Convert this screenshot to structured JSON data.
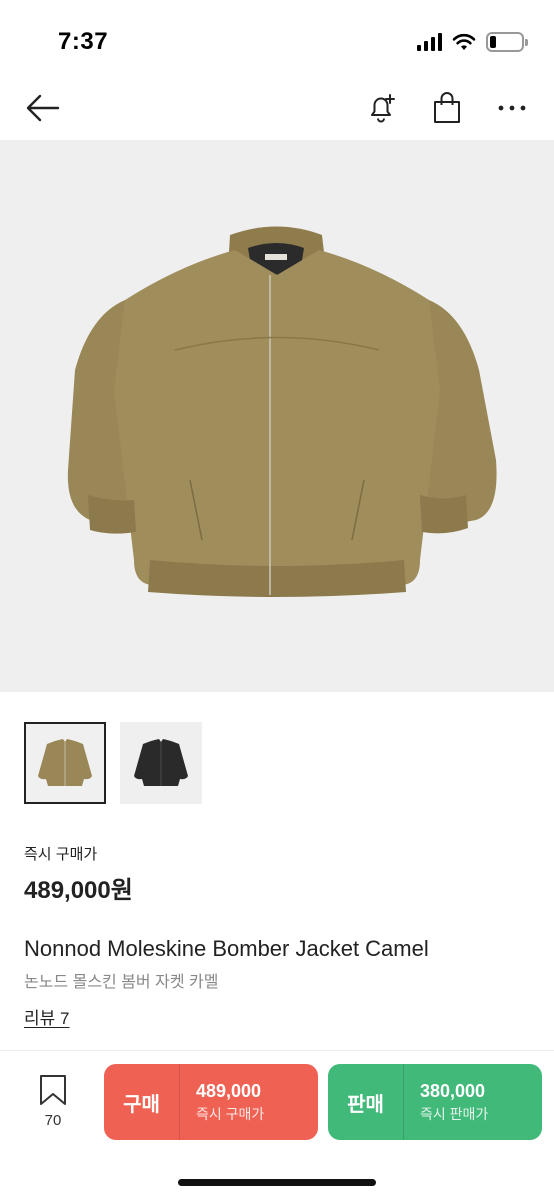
{
  "status_bar": {
    "time": "7:37",
    "battery_level": 0.2
  },
  "nav": {
    "back_icon": "arrow-left-icon",
    "alert_icon": "bell-plus-icon",
    "bag_icon": "shopping-bag-icon",
    "more_icon": "more-horizontal-icon"
  },
  "gallery": {
    "thumbnails": [
      {
        "color": "camel",
        "selected": true
      },
      {
        "color": "black",
        "selected": false
      }
    ]
  },
  "price": {
    "label": "즉시 구매가",
    "value": "489,000원"
  },
  "product": {
    "name": "Nonnod Moleskine Bomber Jacket Camel",
    "name_ko": "논노드 몰스킨 봄버 자켓 카멜",
    "review_label": "리뷰 7"
  },
  "bottom_bar": {
    "wish_count": "70",
    "buy": {
      "title": "구매",
      "price": "489,000",
      "sub": "즉시 구매가",
      "color": "#ef6253"
    },
    "sell": {
      "title": "판매",
      "price": "380,000",
      "sub": "즉시 판매가",
      "color": "#41b979"
    }
  },
  "colors": {
    "jacket_camel": "#9a8757",
    "jacket_black": "#2a2a2a",
    "image_bg": "#efefef"
  }
}
